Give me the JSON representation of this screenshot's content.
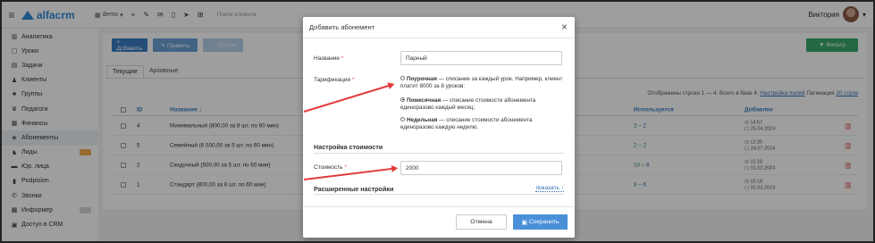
{
  "topbar": {
    "logo_text": "alfacrm",
    "branch_label": "demo",
    "search_placeholder": "Поиск клиента",
    "user_name": "Виктория"
  },
  "sidebar": {
    "items": [
      {
        "label": "Аналитика",
        "icon": "chart-icon"
      },
      {
        "label": "Уроки",
        "icon": "calendar-icon"
      },
      {
        "label": "Задачи",
        "icon": "tasks-icon"
      },
      {
        "label": "Клиенты",
        "icon": "user-icon"
      },
      {
        "label": "Группы",
        "icon": "group-icon"
      },
      {
        "label": "Педагоги",
        "icon": "teacher-icon"
      },
      {
        "label": "Финансы",
        "icon": "money-icon"
      },
      {
        "label": "Абонементы",
        "icon": "tag-icon"
      },
      {
        "label": "Лиды",
        "icon": "leads-icon"
      },
      {
        "label": "Юр. лица",
        "icon": "building-icon"
      },
      {
        "label": "Podpision",
        "icon": "file-icon"
      },
      {
        "label": "Звонки",
        "icon": "phone-icon"
      },
      {
        "label": "Информер",
        "icon": "informer-icon"
      },
      {
        "label": "Доступ в CRM",
        "icon": "lock-icon"
      }
    ]
  },
  "toolbar": {
    "add_label": "+ Добавить",
    "edit_label": "✎ Править",
    "other_label": "··· Другое",
    "filter_label": "▼ Фильтр"
  },
  "tabs": {
    "current": "Текущие",
    "archived": "Архивные"
  },
  "table_info": {
    "shown_text": "Отображены строки 1 — 4. Всего в базе 4.",
    "columns_link": "Настройка полей",
    "pagination_label": "Пагинация",
    "pagination_value": "20 строк"
  },
  "table": {
    "headers": {
      "id": "ID",
      "name": "Название ↓",
      "used": "Используется",
      "added": "Добавлен"
    },
    "rows": [
      {
        "id": "4",
        "name": "Минимальный (800,00 за 8 шт. по 60 мин)",
        "used_a": "2",
        "used_b": "2",
        "added_time": "14:57",
        "added_date": "25.04.2024"
      },
      {
        "id": "5",
        "name": "Семейный (6 500,00 за 5 шт. по 60 мин)",
        "used_a": "2",
        "used_b": "2",
        "added_time": "12:35",
        "added_date": "24.07.2024"
      },
      {
        "id": "2",
        "name": "Скидочный (500,00 за 5 шт. по 60 мин)",
        "used_a": "10",
        "used_b": "8",
        "added_time": "15:18",
        "added_date": "01.02.2024"
      },
      {
        "id": "1",
        "name": "Стандарт (800,00 за 8 шт. по 60 мин)",
        "used_a": "8",
        "used_b": "6",
        "added_time": "15:18",
        "added_date": "01.02.2024"
      }
    ]
  },
  "modal": {
    "title": "Добавить абонемент",
    "name_label": "Название",
    "name_value": "Парный",
    "billing_label": "Тарификация",
    "options": [
      {
        "title": "Поурочная",
        "text": " — списание за каждый урок. Например, клиент платит 8000 за 8 уроков:",
        "checked": false
      },
      {
        "title": "Помесячная",
        "text": " — списание стоимости абонемента единоразово каждый месяц;",
        "checked": true
      },
      {
        "title": "Недельная",
        "text": " — списание стоимости абонемента единоразово каждую неделю.",
        "checked": false
      }
    ],
    "price_section": "Настройка стоимости",
    "price_label": "Стоимость",
    "price_value": "2000",
    "advanced_section": "Расширенные настройки",
    "show_link": "показать ↑",
    "cancel_label": "Отмена",
    "save_label": "Сохранить"
  }
}
